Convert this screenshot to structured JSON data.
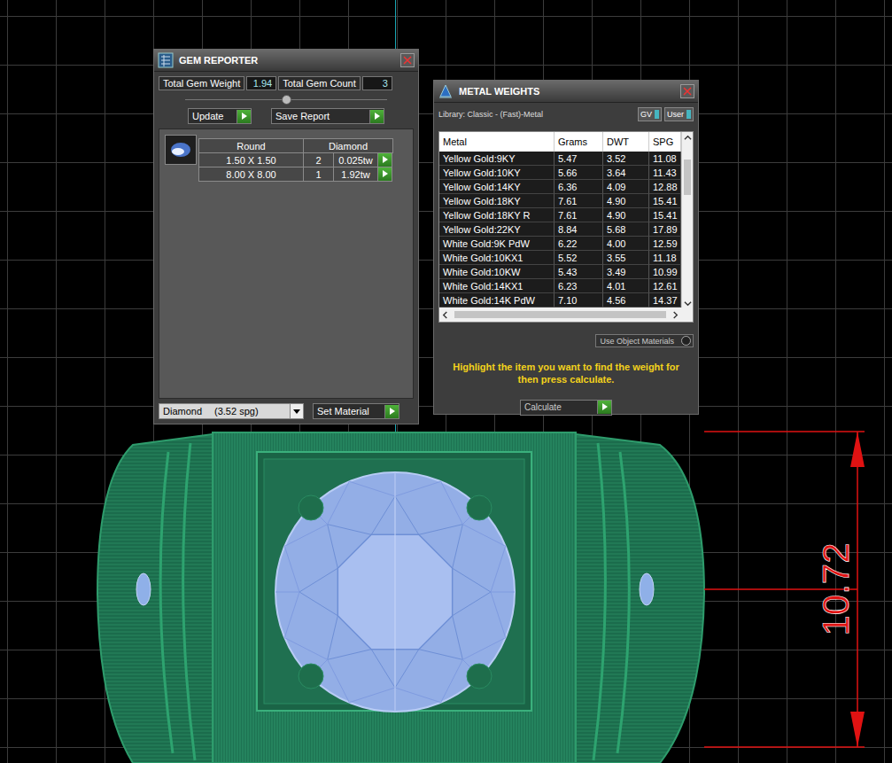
{
  "gem_reporter": {
    "title": "GEM REPORTER",
    "summary": [
      {
        "label": "Total Gem Weight",
        "value": "1.94"
      },
      {
        "label": "Total Gem Count",
        "value": "3"
      }
    ],
    "buttons": [
      "Update",
      "Save Report"
    ],
    "table": {
      "columns": [
        "Round",
        "Diamond"
      ],
      "rows": [
        {
          "size": "1.50 X 1.50",
          "count": "2",
          "weight": "0.025tw"
        },
        {
          "size": "8.00 X 8.00",
          "count": "1",
          "weight": "1.92tw"
        }
      ]
    },
    "material": {
      "value": "Diamond",
      "spg": "(3.52 spg)"
    },
    "set_button": "Set Material"
  },
  "metal_weights": {
    "title": "METAL WEIGHTS",
    "library": "Library: Classic - (Fast)-Metal",
    "toggles": [
      {
        "label": "GV",
        "on": true
      },
      {
        "label": "User",
        "on": true
      }
    ],
    "columns": [
      "Metal",
      "Grams",
      "DWT",
      "SPG"
    ],
    "rows": [
      [
        "Yellow Gold:9KY",
        "5.47",
        "3.52",
        "11.08"
      ],
      [
        "Yellow Gold:10KY",
        "5.66",
        "3.64",
        "11.43"
      ],
      [
        "Yellow Gold:14KY",
        "6.36",
        "4.09",
        "12.88"
      ],
      [
        "Yellow Gold:18KY",
        "7.61",
        "4.90",
        "15.41"
      ],
      [
        "Yellow Gold:18KY R",
        "7.61",
        "4.90",
        "15.41"
      ],
      [
        "Yellow Gold:22KY",
        "8.84",
        "5.68",
        "17.89"
      ],
      [
        "White Gold:9K PdW",
        "6.22",
        "4.00",
        "12.59"
      ],
      [
        "White Gold:10KX1",
        "5.52",
        "3.55",
        "11.18"
      ],
      [
        "White Gold:10KW",
        "5.43",
        "3.49",
        "10.99"
      ],
      [
        "White Gold:14KX1",
        "6.23",
        "4.01",
        "12.61"
      ],
      [
        "White Gold:14K PdW",
        "7.10",
        "4.56",
        "14.37"
      ]
    ],
    "use_object_materials": {
      "label": "Use Object Materials",
      "checked": false
    },
    "hint": "Highlight the item you want to find the weight for then press calculate.",
    "calculate": "Calculate"
  },
  "dimension": {
    "value": "10.72"
  }
}
